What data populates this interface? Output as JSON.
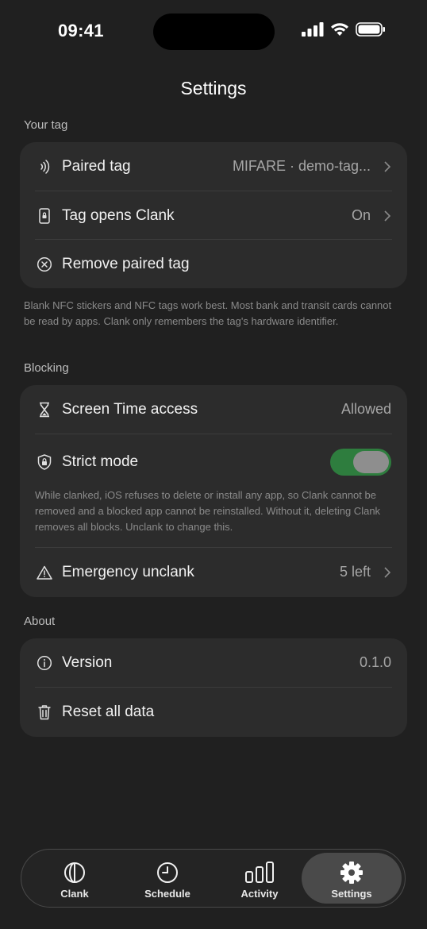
{
  "status_bar": {
    "time": "09:41"
  },
  "header": {
    "title": "Settings"
  },
  "your_tag": {
    "section_label": "Your tag",
    "rows": [
      {
        "label": "Paired tag",
        "value": "MIFARE · demo-tag...",
        "icon": "nfc-icon"
      },
      {
        "label": "Tag opens Clank",
        "value": "On",
        "icon": "phone-lock-icon"
      },
      {
        "label": "Remove paired tag",
        "icon": "remove-circle-icon"
      }
    ],
    "footnote": "Blank NFC stickers and NFC tags work best. Most bank and transit cards cannot be read by apps. Clank only remembers the tag's hardware identifier."
  },
  "blocking": {
    "section_label": "Blocking",
    "screen_time": {
      "label": "Screen Time access",
      "value": "Allowed",
      "icon": "hourglass-icon"
    },
    "strict_mode": {
      "label": "Strict mode",
      "enabled": true,
      "icon": "shield-lock-icon",
      "note": "While clanked, iOS refuses to delete or install any app, so Clank cannot be removed and a blocked app cannot be reinstalled. Without it, deleting Clank removes all blocks. Unclank to change this."
    },
    "emergency": {
      "label": "Emergency unclank",
      "value": "5 left",
      "icon": "warning-icon"
    }
  },
  "about": {
    "section_label": "About",
    "version": {
      "label": "Version",
      "value": "0.1.0",
      "icon": "info-icon"
    },
    "reset": {
      "label": "Reset all data",
      "icon": "trash-icon"
    }
  },
  "tabbar": {
    "tabs": [
      {
        "label": "Clank",
        "icon": "clank-icon"
      },
      {
        "label": "Schedule",
        "icon": "clock-icon"
      },
      {
        "label": "Activity",
        "icon": "bar-chart-icon"
      },
      {
        "label": "Settings",
        "icon": "gear-icon",
        "active": true
      }
    ]
  },
  "colors": {
    "background": "#202020",
    "card": "#2c2c2c",
    "toggle_on": "#2e7d3e"
  }
}
